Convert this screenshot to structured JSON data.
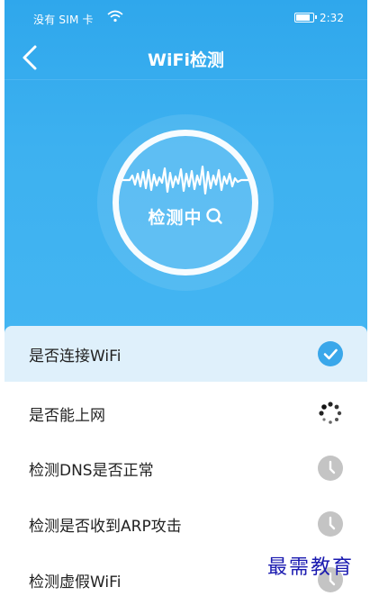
{
  "status_bar": {
    "carrier": "没有 SIM 卡",
    "time": "2:32",
    "icons": [
      "sim-missing-icon",
      "wifi-icon",
      "battery-icon"
    ]
  },
  "header": {
    "title": "WiFi检测",
    "back_icon": "chevron-left-icon"
  },
  "gauge": {
    "status_text": "检测中",
    "icons": [
      "waveform-icon",
      "search-icon"
    ]
  },
  "checklist": {
    "items": [
      {
        "label": "是否连接WiFi",
        "state": "done",
        "icon": "check-circle-icon"
      },
      {
        "label": "是否能上网",
        "state": "loading",
        "icon": "spinner-icon"
      },
      {
        "label": "检测DNS是否正常",
        "state": "pending",
        "icon": "clock-icon"
      },
      {
        "label": "检测是否收到ARP攻击",
        "state": "pending",
        "icon": "clock-icon"
      },
      {
        "label": "检测虚假WiFi",
        "state": "pending",
        "icon": "clock-icon"
      }
    ]
  },
  "watermark": "最需教育",
  "colors": {
    "primary": "#3aa7ea",
    "active_row": "#dff0fb",
    "pending_icon": "#c4c4c4"
  }
}
